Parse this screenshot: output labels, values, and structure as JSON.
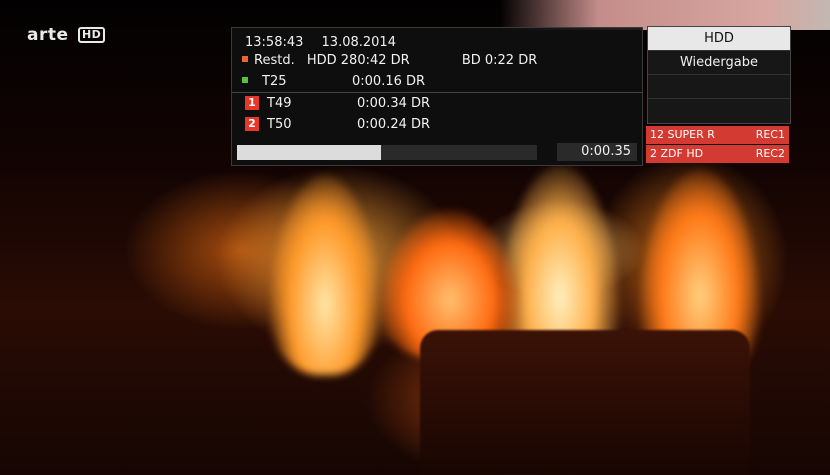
{
  "channel": {
    "name": "arte",
    "quality": "HD"
  },
  "status": {
    "time": "13:58:43",
    "date": "13.08.2014",
    "restd_label": "Restd.",
    "hdd_value": "HDD 280:42 DR",
    "bd_value": "BD  0:22 DR",
    "timers": [
      {
        "name": "T25",
        "value": "0:00.16  DR",
        "marker": "green-square"
      },
      {
        "name": "T49",
        "value": "0:00.34  DR",
        "marker": "1"
      },
      {
        "name": "T50",
        "value": "0:00.24  DR",
        "marker": "2"
      }
    ],
    "progress_fraction": 0.48,
    "elapsed": "0:00.35"
  },
  "menu": {
    "items": [
      "HDD",
      "Wiedergabe",
      "",
      ""
    ]
  },
  "recordings": [
    {
      "left": "12 SUPER R",
      "right": "REC1"
    },
    {
      "left": "2 ZDF HD",
      "right": "REC2"
    }
  ],
  "colors": {
    "accent_red": "#d33a31",
    "panel_bg": "#101010",
    "selected_menu": "#e8e8e8"
  }
}
